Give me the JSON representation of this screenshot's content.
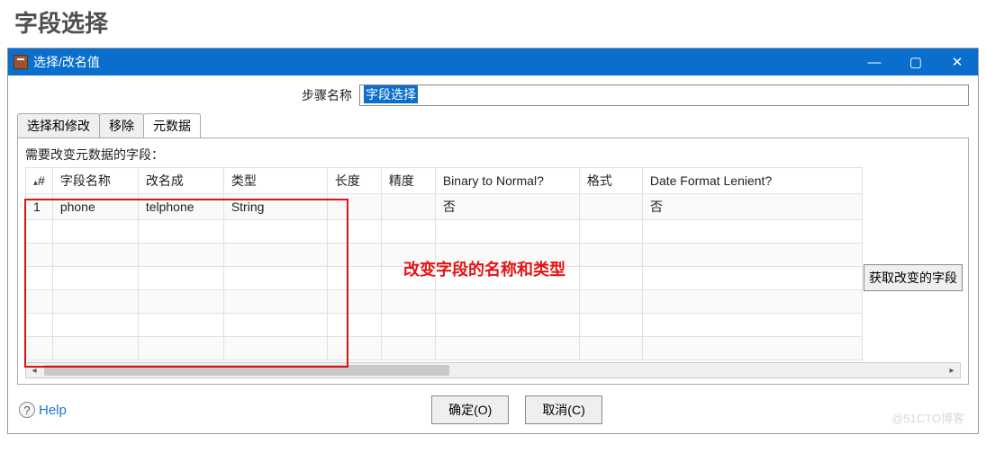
{
  "page_heading": "字段选择",
  "window": {
    "title": "选择/改名值"
  },
  "step": {
    "label": "步骤名称",
    "value": "字段选择"
  },
  "tabs": [
    {
      "label": "选择和修改",
      "active": false
    },
    {
      "label": "移除",
      "active": false
    },
    {
      "label": "元数据",
      "active": true
    }
  ],
  "pane": {
    "description": "需要改变元数据的字段："
  },
  "table": {
    "headers": {
      "num": "#",
      "field": "字段名称",
      "rename": "改名成",
      "type": "类型",
      "length": "长度",
      "precision": "精度",
      "b2n": "Binary to Normal?",
      "format": "格式",
      "lenient": "Date Format Lenient?"
    },
    "rows": [
      {
        "num": "1",
        "field": "phone",
        "rename": "telphone",
        "type": "String",
        "length": "",
        "precision": "",
        "b2n": "否",
        "format": "",
        "lenient": "否"
      }
    ]
  },
  "overlay_text": "改变字段的名称和类型",
  "side_button": "获取改变的字段",
  "footer": {
    "help": "Help",
    "ok": "确定(O)",
    "cancel": "取消(C)"
  },
  "watermark": "@51CTO博客"
}
